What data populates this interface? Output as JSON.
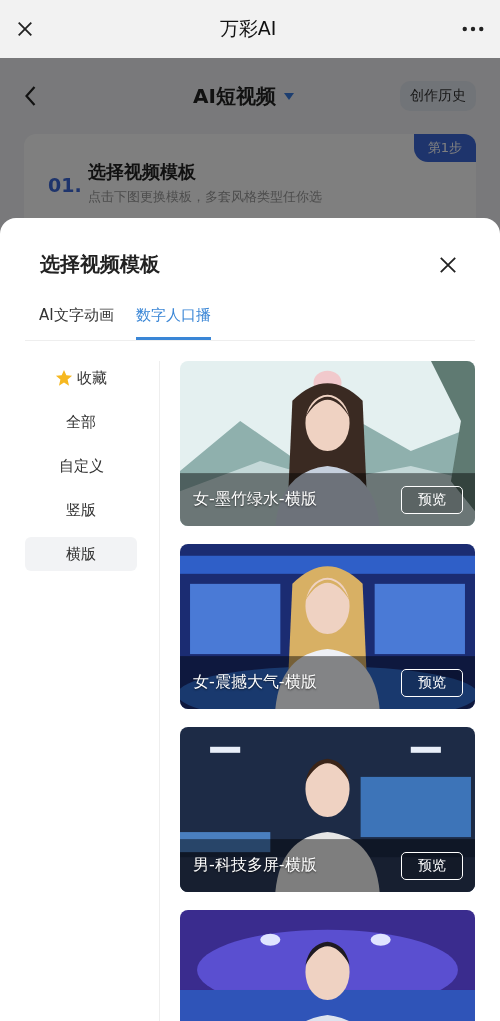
{
  "app_bar": {
    "title": "万彩AI"
  },
  "page": {
    "title": "AI短视频",
    "history_button": "创作历史",
    "step": {
      "badge": "第1步",
      "number": "01.",
      "title": "选择视频模板",
      "subtitle": "点击下图更换模板，多套风格类型任你选"
    }
  },
  "sheet": {
    "title": "选择视频模板",
    "tabs": [
      {
        "label": "AI文字动画",
        "selected": false
      },
      {
        "label": "数字人口播",
        "selected": true
      }
    ],
    "categories": [
      {
        "label": "收藏",
        "kind": "favorite",
        "selected": false
      },
      {
        "label": "全部",
        "kind": "plain",
        "selected": false
      },
      {
        "label": "自定义",
        "kind": "plain",
        "selected": false
      },
      {
        "label": "竖版",
        "kind": "plain",
        "selected": false
      },
      {
        "label": "横版",
        "kind": "plain",
        "selected": true
      }
    ],
    "templates": [
      {
        "kind": "template",
        "title": "女-墨竹绿水-横版",
        "button": "预览"
      },
      {
        "kind": "template",
        "title": "女-震撼大气-横版",
        "button": "预览"
      },
      {
        "kind": "template",
        "title": "男-科技多屏-横版",
        "button": "预览"
      },
      {
        "kind": "picture"
      }
    ]
  }
}
